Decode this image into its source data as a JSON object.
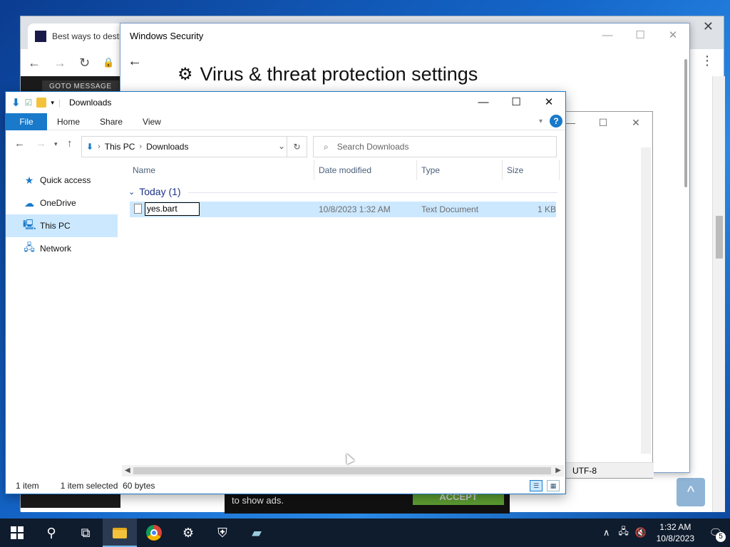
{
  "chrome": {
    "tab_title": "Best ways to destr",
    "overlay_text": "GOTO MESSAGE",
    "ad_text": "to show ads.",
    "ad_button": "ACCEPT"
  },
  "windows_security": {
    "title": "Windows Security",
    "heading": "Virus & threat protection settings"
  },
  "notepad": {
    "encoding": "UTF-8"
  },
  "explorer": {
    "title": "Downloads",
    "ribbon_tabs": {
      "file": "File",
      "home": "Home",
      "share": "Share",
      "view": "View"
    },
    "address": {
      "root": "This PC",
      "folder": "Downloads"
    },
    "search_placeholder": "Search Downloads",
    "nav": {
      "quick_access": "Quick access",
      "onedrive": "OneDrive",
      "this_pc": "This PC",
      "network": "Network"
    },
    "columns": {
      "name": "Name",
      "date": "Date modified",
      "type": "Type",
      "size": "Size"
    },
    "group": "Today (1)",
    "file": {
      "rename_value": "yes.bart",
      "date": "10/8/2023 1:32 AM",
      "type": "Text Document",
      "size": "1 KB"
    },
    "status": {
      "count": "1 item",
      "selected": "1 item selected  60 bytes"
    }
  },
  "taskbar": {
    "time": "1:32 AM",
    "date": "10/8/2023",
    "notification_count": "5"
  }
}
